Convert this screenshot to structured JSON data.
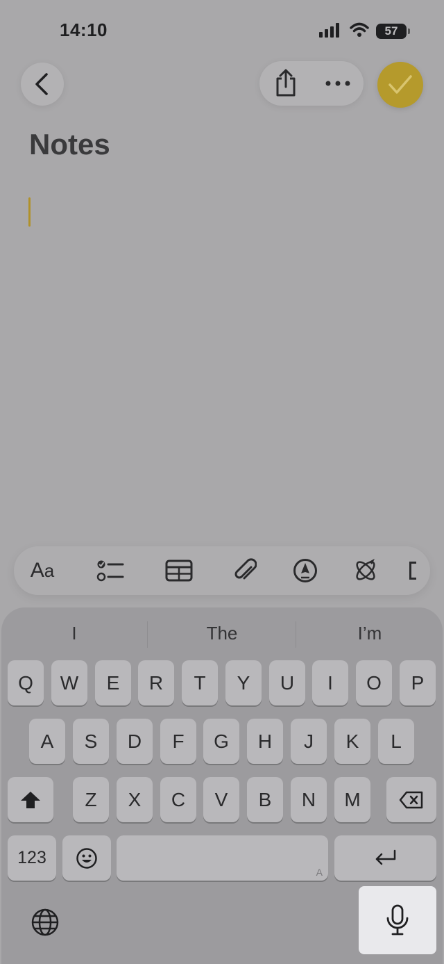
{
  "status_bar": {
    "time": "14:10",
    "battery": "57"
  },
  "note": {
    "title": "Notes"
  },
  "keyboard": {
    "suggestions": [
      "I",
      "The",
      "I’m"
    ],
    "row1": [
      "Q",
      "W",
      "E",
      "R",
      "T",
      "Y",
      "U",
      "I",
      "O",
      "P"
    ],
    "row2": [
      "A",
      "S",
      "D",
      "F",
      "G",
      "H",
      "J",
      "K",
      "L"
    ],
    "row3": [
      "Z",
      "X",
      "C",
      "V",
      "B",
      "N",
      "M"
    ],
    "numbers_key": "123",
    "space_hint": "A"
  },
  "colors": {
    "accent": "#b59a2c",
    "background": "#a9a8aa",
    "keyboard": "#9c9b9e"
  }
}
